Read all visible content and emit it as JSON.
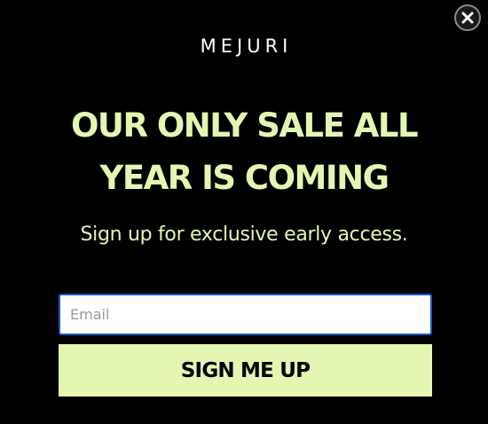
{
  "modal": {
    "brand": "MEJURI",
    "headline_line1": "OUR ONLY SALE ALL",
    "headline_line2": "YEAR IS COMING",
    "subhead": "Sign up for exclusive early access.",
    "email": {
      "value": "",
      "placeholder": "Email"
    },
    "submit_label": "SIGN ME UP",
    "close_icon": "close-icon"
  },
  "colors": {
    "background": "#000000",
    "accent": "#e3f7b2",
    "logo": "#ffffff",
    "input_border": "#1a56c6"
  }
}
